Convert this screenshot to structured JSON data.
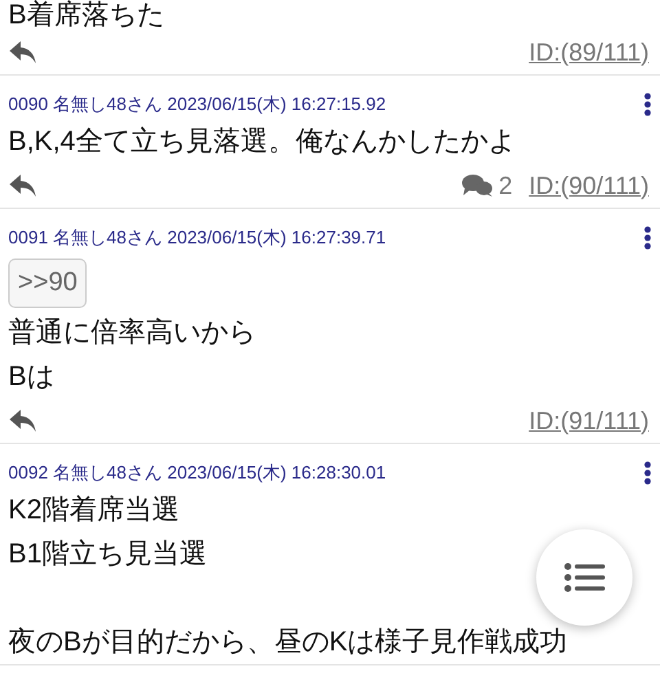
{
  "posts": [
    {
      "body": [
        {
          "kind": "text",
          "text": "B着席落ちた"
        }
      ],
      "id": "ID:(89/111)"
    },
    {
      "header": "0090 名無し48さん 2023/06/15(木) 16:27:15.92",
      "body": [
        {
          "kind": "text",
          "text": "B,K,4全て立ち見落選。俺なんかしたかよ"
        }
      ],
      "replies": "2",
      "id": "ID:(90/111)"
    },
    {
      "header": "0091 名無し48さん 2023/06/15(木) 16:27:39.71",
      "body": [
        {
          "kind": "anchor",
          "text": ">>90"
        },
        {
          "kind": "text",
          "text": "普通に倍率高いから"
        },
        {
          "kind": "text",
          "text": "Bは"
        }
      ],
      "id": "ID:(91/111)"
    },
    {
      "header": "0092 名無し48さん 2023/06/15(木) 16:28:30.01",
      "body": [
        {
          "kind": "text",
          "text": "K2階着席当選"
        },
        {
          "kind": "text",
          "text": "B1階立ち見当選"
        },
        {
          "kind": "gap"
        },
        {
          "kind": "text",
          "text": "夜のBが目的だから、昼のKは様子見作戦成功"
        }
      ]
    }
  ]
}
